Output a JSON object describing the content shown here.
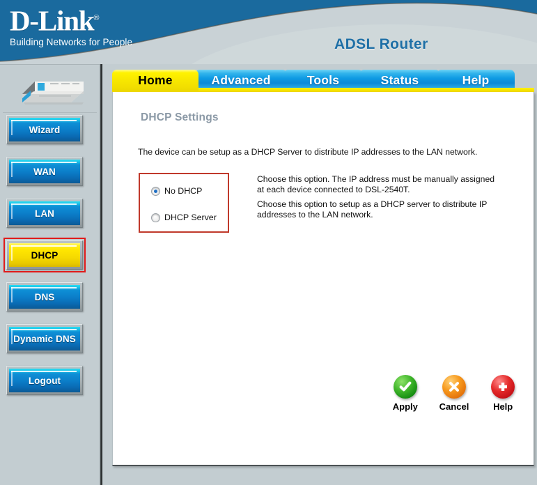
{
  "header": {
    "brand": "D-Link",
    "brand_registered": "®",
    "tagline": "Building Networks for People",
    "product_title": "ADSL Router",
    "brand_blue": "#1a6a9e",
    "header_gray": "#c9d2d6"
  },
  "sidebar": {
    "device_icon": "router-device-image",
    "items": [
      {
        "label": "Wizard",
        "name": "wizard",
        "active": false,
        "highlighted": false
      },
      {
        "label": "WAN",
        "name": "wan",
        "active": false,
        "highlighted": false
      },
      {
        "label": "LAN",
        "name": "lan",
        "active": false,
        "highlighted": false
      },
      {
        "label": "DHCP",
        "name": "dhcp",
        "active": true,
        "highlighted": true
      },
      {
        "label": "DNS",
        "name": "dns",
        "active": false,
        "highlighted": false
      },
      {
        "label": "Dynamic DNS",
        "name": "dynamic-dns",
        "active": false,
        "highlighted": false
      },
      {
        "label": "Logout",
        "name": "logout",
        "active": false,
        "highlighted": false
      }
    ]
  },
  "tabs": [
    {
      "label": "Home",
      "active": true
    },
    {
      "label": "Advanced",
      "active": false
    },
    {
      "label": "Tools",
      "active": false
    },
    {
      "label": "Status",
      "active": false
    },
    {
      "label": "Help",
      "active": false
    }
  ],
  "main": {
    "page_title": "DHCP Settings",
    "description": "The device can be setup as a DHCP Server to distribute IP addresses to the LAN network.",
    "options": [
      {
        "label": "No DHCP",
        "selected": true,
        "description": "Choose this option. The IP address must be manually assigned at each device connected to DSL-2540T."
      },
      {
        "label": "DHCP Server",
        "selected": false,
        "description": "Choose this option to setup as a DHCP server to distribute IP addresses to the LAN network."
      }
    ],
    "highlight_color": "#c0392b"
  },
  "actions": [
    {
      "label": "Apply",
      "icon": "check-circle-icon",
      "color": "#2ea01a"
    },
    {
      "label": "Cancel",
      "icon": "x-circle-icon",
      "color": "#ef8c12"
    },
    {
      "label": "Help",
      "icon": "plus-circle-icon",
      "color": "#d8131c"
    }
  ]
}
